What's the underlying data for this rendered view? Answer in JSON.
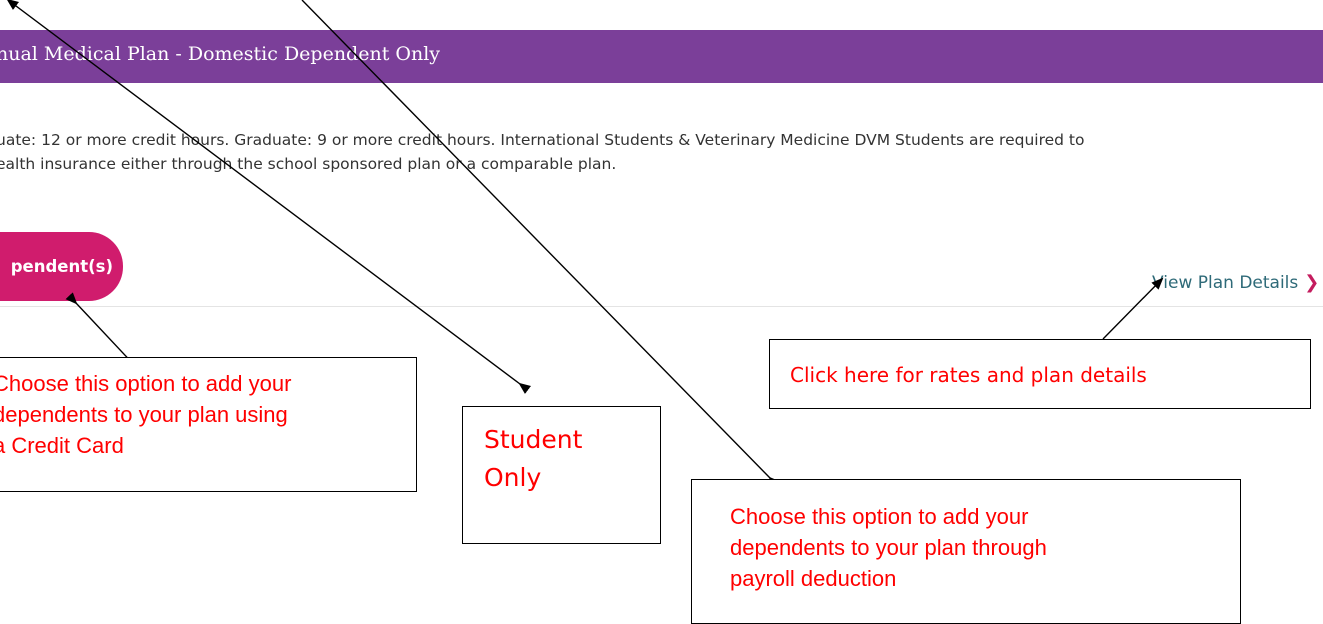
{
  "plan": {
    "title": "nual Medical Plan - Domestic Dependent Only",
    "requirement_line1": "uate: 12 or more credit hours. Graduate: 9 or more credit hours. International Students & Veterinary Medicine DVM Students are required to",
    "requirement_line2": "ealth insurance either through the school sponsored plan or a comparable plan.",
    "add_dependents_label": "pendent(s)",
    "view_details_label": "View Plan Details",
    "chevron": "❯"
  },
  "callouts": {
    "credit_card_line1": "Choose this option to add your",
    "credit_card_line2": "dependents to your plan using",
    "credit_card_line3": "a Credit Card",
    "student_line1": "Student",
    "student_line2": "Only",
    "rates": "Click here for rates and plan details",
    "payroll_line1": "Choose this option to add your",
    "payroll_line2": "dependents to your plan through",
    "payroll_line3": "payroll deduction"
  },
  "colors": {
    "header": "#7b3f99",
    "button": "#d01c6d",
    "link": "#2e6a78",
    "callout_text": "#ff0000"
  }
}
